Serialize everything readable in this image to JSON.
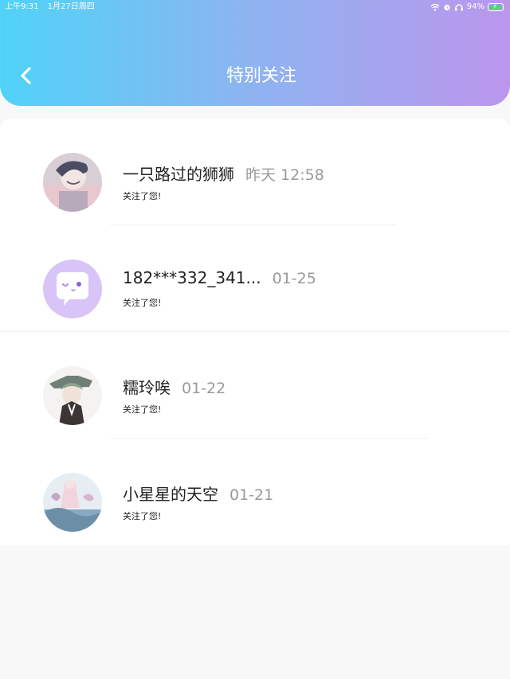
{
  "status_bar": {
    "time": "上午9:31",
    "date": "1月27日周四",
    "battery": "94%",
    "battery_level": 0.94
  },
  "header": {
    "title": "特别关注",
    "back_icon": "chevron-left-icon"
  },
  "colors": {
    "header_gradient_start": "#4fd3f8",
    "header_gradient_end": "#bb96ec",
    "background": "#f9f8f9",
    "time_text": "#9a9a9a"
  },
  "follows": [
    {
      "name": "一只路过的狮狮",
      "time": "昨天 12:58",
      "message": "关注了您!"
    },
    {
      "name": "182***332_341...",
      "time": "01-25",
      "message": "关注了您!"
    },
    {
      "name": "糯玲唉",
      "time": "01-22",
      "message": "关注了您!"
    },
    {
      "name": "小星星的天空",
      "time": "01-21",
      "message": "关注了您!"
    }
  ]
}
